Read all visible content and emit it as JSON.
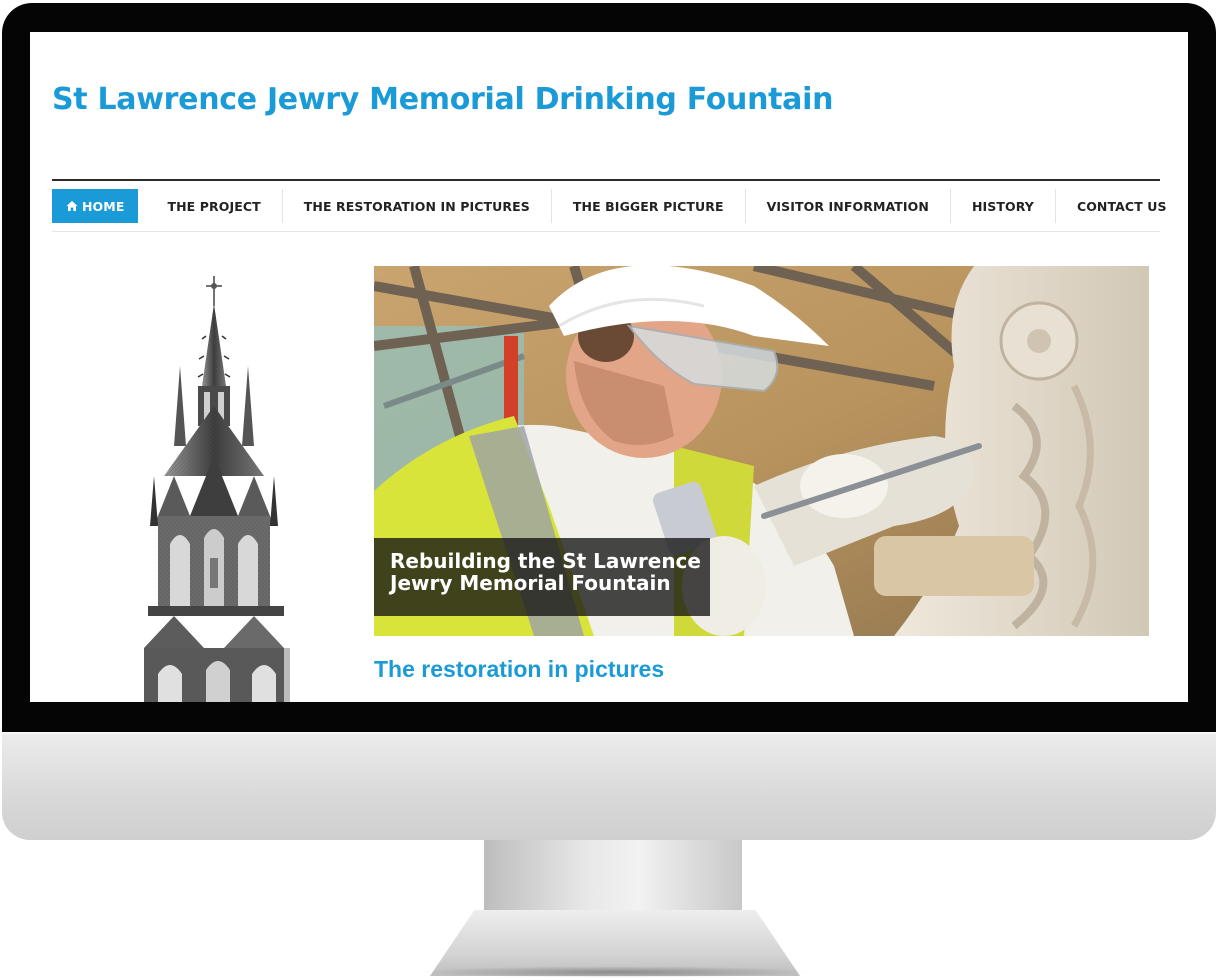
{
  "site": {
    "title": "St Lawrence Jewry Memorial Drinking Fountain",
    "accent_color": "#1a9ad6"
  },
  "nav": {
    "items": [
      {
        "label": "HOME",
        "icon": "home-icon",
        "active": true
      },
      {
        "label": "THE PROJECT",
        "active": false
      },
      {
        "label": "THE RESTORATION IN PICTURES",
        "active": false
      },
      {
        "label": "THE BIGGER PICTURE",
        "active": false
      },
      {
        "label": "VISITOR INFORMATION",
        "active": false
      },
      {
        "label": "HISTORY",
        "active": false
      },
      {
        "label": "CONTACT US",
        "active": false
      }
    ],
    "search_icon": "search-icon"
  },
  "hero": {
    "caption_line1": "Rebuilding the St Lawrence",
    "caption_line2": "Jewry Memorial Fountain"
  },
  "content": {
    "section_heading": "The restoration in pictures"
  }
}
